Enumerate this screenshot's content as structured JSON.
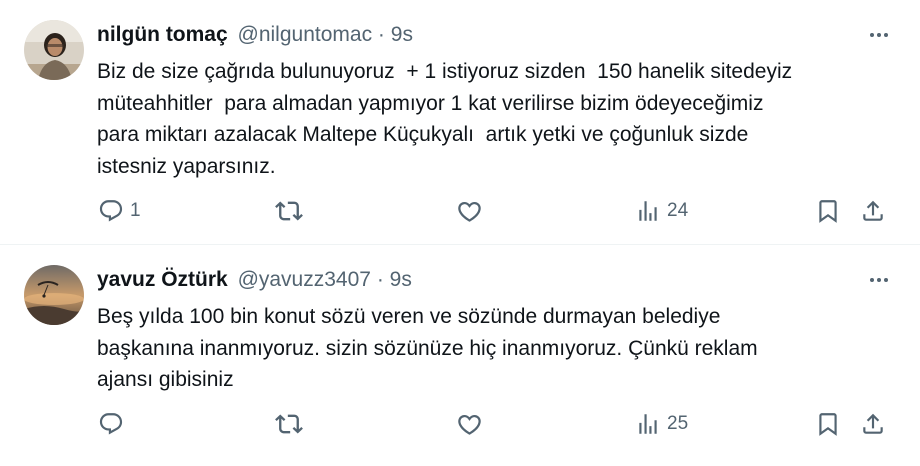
{
  "tweets": [
    {
      "name": "nilgün tomaç",
      "handle": "@nilguntomac",
      "separator": "·",
      "time": "9s",
      "text": "Biz de size çağrıda bulunuyoruz  + 1 istiyoruz sizden  150 hanelik sitedeyiz\nmüteahhitler  para almadan yapmıyor 1 kat verilirse bizim ödeyeceğimiz\npara miktarı azalacak Maltepe Küçukyalı  artık yetki ve çoğunluk sizde\nistesniz yaparsınız.",
      "reply_count": "1",
      "retweet_count": "",
      "like_count": "",
      "view_count": "24"
    },
    {
      "name": "yavuz Öztürk",
      "handle": "@yavuzz3407",
      "separator": "·",
      "time": "9s",
      "text": "Beş yılda 100 bin konut sözü veren ve sözünde durmayan belediye\nbaşkanına inanmıyoruz. sizin sözünüze hiç inanmıyoruz. Çünkü reklam\najansı gibisiniz",
      "reply_count": "",
      "retweet_count": "",
      "like_count": "",
      "view_count": "25"
    }
  ],
  "icons": {
    "reply": "reply-icon",
    "retweet": "retweet-icon",
    "like": "like-icon",
    "views": "views-icon",
    "bookmark": "bookmark-icon",
    "share": "share-icon",
    "more": "more-icon"
  },
  "colors": {
    "text": "#0f1419",
    "secondary": "#536471",
    "divider": "#eff3f4"
  }
}
